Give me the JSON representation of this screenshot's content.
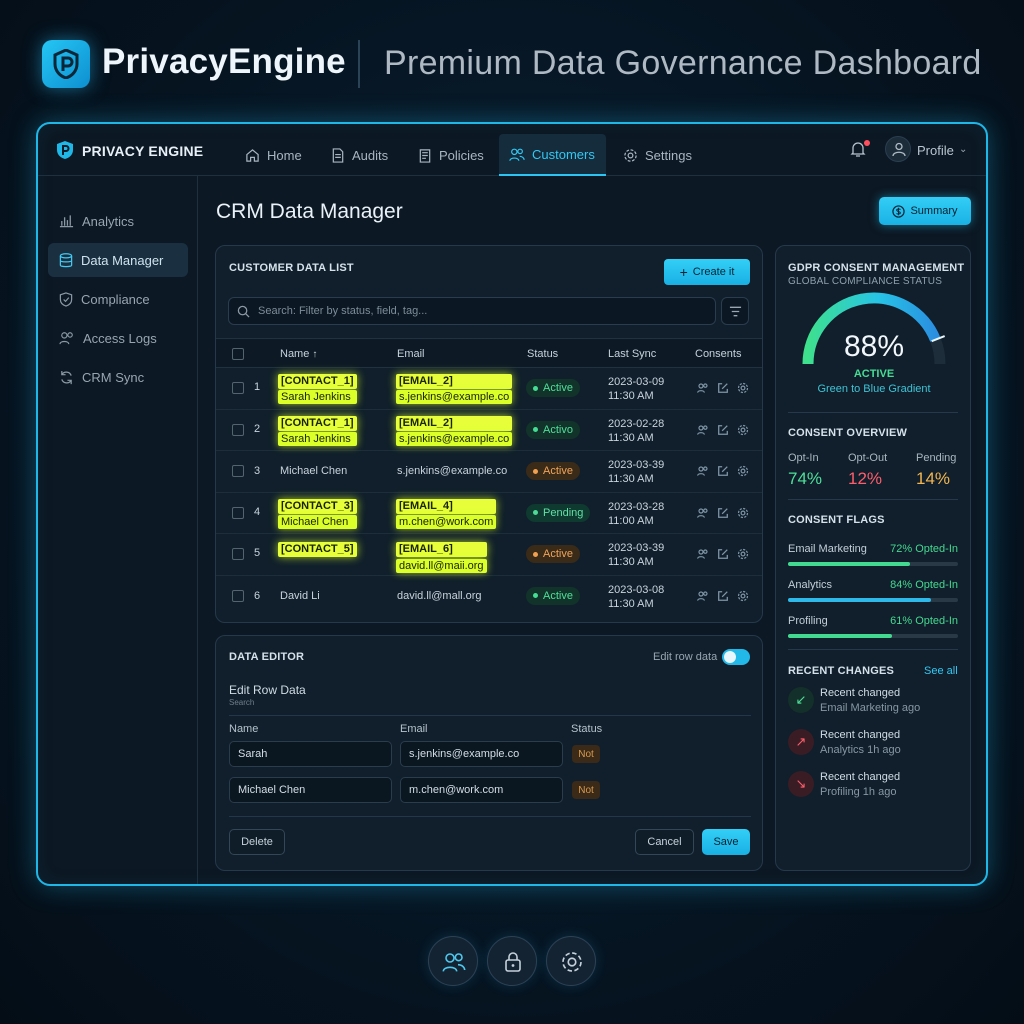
{
  "brand": {
    "name": "PrivacyEngine",
    "subtitle": "Premium Data Governance Dashboard"
  },
  "app": {
    "logo_text": "PRIVACY ENGINE"
  },
  "nav": {
    "items": [
      {
        "label": "Home",
        "icon": "home-icon"
      },
      {
        "label": "Audits",
        "icon": "document-icon"
      },
      {
        "label": "Policies",
        "icon": "clipboard-icon"
      },
      {
        "label": "Customers",
        "icon": "users-icon",
        "active": true
      },
      {
        "label": "Settings",
        "icon": "gear-icon"
      }
    ],
    "profile": "Profile"
  },
  "sidebar": {
    "items": [
      {
        "label": "Analytics",
        "icon": "bar-chart-icon"
      },
      {
        "label": "Data Manager",
        "icon": "database-icon",
        "active": true
      },
      {
        "label": "Compliance",
        "icon": "shield-icon"
      },
      {
        "label": "Access Logs",
        "icon": "users-icon"
      },
      {
        "label": "CRM Sync",
        "icon": "sync-icon"
      }
    ]
  },
  "main": {
    "title": "CRM Data Manager",
    "summary_label": "Summary"
  },
  "customer_list": {
    "title": "CUSTOMER DATA LIST",
    "create_label": "Create it",
    "search_placeholder": "Search: Filter by status, field, tag...",
    "headers": {
      "name": "Name",
      "email": "Email",
      "status": "Status",
      "last_sync": "Last Sync",
      "consents": "Consents"
    },
    "rows": [
      {
        "num": "1",
        "name_tag": "[CONTACT_1]",
        "name": "Sarah Jenkins",
        "email_tag": "[EMAIL_2]",
        "email": "s.jenkins@example.co",
        "status": "Active",
        "sync_date": "2023-03-09",
        "sync_time": "11:30 AM"
      },
      {
        "num": "2",
        "name_tag": "[CONTACT_1]",
        "name": "Sarah Jenkins",
        "email_tag": "[EMAIL_2]",
        "email": "s.jenkins@example.co",
        "status": "Activo",
        "sync_date": "2023-02-28",
        "sync_time": "11:30 AM"
      },
      {
        "num": "3",
        "name": "Michael Chen",
        "email": "s.jenkins@example.co",
        "status": "Active",
        "sync_date": "2023-03-39",
        "sync_time": "11:30 AM"
      },
      {
        "num": "4",
        "name_tag": "[CONTACT_3]",
        "name": "Michael Chen",
        "email_tag": "[EMAIL_4]",
        "email": "m.chen@work.com",
        "status": "Pending",
        "sync_date": "2023-03-28",
        "sync_time": "11:00 AM"
      },
      {
        "num": "5",
        "name_tag": "[CONTACT_5]",
        "email_tag": "[EMAIL_6]",
        "email": "david.ll@maii.org",
        "status": "Active",
        "sync_date": "2023-03-39",
        "sync_time": "11:30 AM"
      },
      {
        "num": "6",
        "name": "David Li",
        "email": "david.ll@mall.org",
        "status": "Active",
        "sync_date": "2023-03-08",
        "sync_time": "11:30 AM"
      }
    ]
  },
  "editor": {
    "title": "DATA EDITOR",
    "toggle_label": "Edit row data",
    "section_title": "Edit Row Data",
    "section_sub": "Search",
    "headers": {
      "name": "Name",
      "email": "Email",
      "status": "Status"
    },
    "rows": [
      {
        "name": "Sarah",
        "email": "s.jenkins@example.co",
        "status": "Not"
      },
      {
        "name": "Michael Chen",
        "email": "m.chen@work.com",
        "status": "Not"
      }
    ],
    "delete_label": "Delete",
    "cancel_label": "Cancel",
    "save_label": "Save"
  },
  "gdpr": {
    "title": "GDPR CONSENT MANAGEMENT",
    "subtitle": "GLOBAL COMPLIANCE STATUS",
    "gauge_value": "88%",
    "gauge_fraction": 0.88,
    "gauge_status": "ACTIVE",
    "gauge_caption": "Green to Blue Gradient",
    "overview_title": "CONSENT OVERVIEW",
    "overview": [
      {
        "label": "Opt-In",
        "value": "74%",
        "color": "#4ee09a"
      },
      {
        "label": "Opt-Out",
        "value": "12%",
        "color": "#ff5d6c"
      },
      {
        "label": "Pending",
        "value": "14%",
        "color": "#f2b550"
      }
    ],
    "flags_title": "CONSENT FLAGS",
    "flags": [
      {
        "label": "Email Marketing",
        "value": "72% Opted-In",
        "fraction": 0.72,
        "color": "#44d990"
      },
      {
        "label": "Analytics",
        "value": "84% Opted-In",
        "fraction": 0.84,
        "color": "#2fb8ea"
      },
      {
        "label": "Profiling",
        "value": "61% Opted-In",
        "fraction": 0.61,
        "color": "#44d990"
      }
    ],
    "changes_title": "RECENT CHANGES",
    "see_all": "See all",
    "changes": [
      {
        "title": "Recent changed",
        "sub": "Email Marketing ago",
        "icon": "arrow-down-left-icon",
        "color": "#4ee09a"
      },
      {
        "title": "Recent changed",
        "sub": "Analytics 1h ago",
        "icon": "arrow-up-right-icon",
        "color": "#ff5d6c"
      },
      {
        "title": "Recent changed",
        "sub": "Profiling 1h ago",
        "icon": "arrow-down-right-icon",
        "color": "#ff5d6c"
      }
    ]
  },
  "dock": [
    {
      "icon": "users-icon"
    },
    {
      "icon": "lock-icon"
    },
    {
      "icon": "gear-icon"
    }
  ]
}
